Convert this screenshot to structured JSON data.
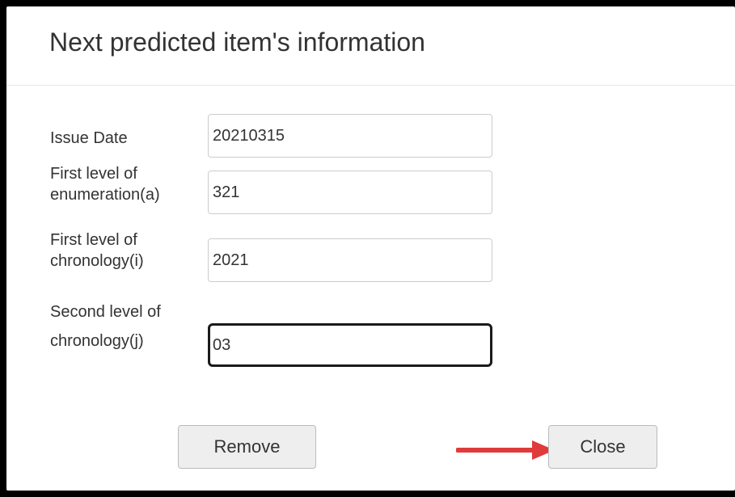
{
  "dialog": {
    "title": "Next predicted item's information"
  },
  "fields": {
    "issue_date": {
      "label": "Issue Date",
      "value": "20210315"
    },
    "enumeration_a": {
      "label": "First level of enumeration(a)",
      "value": "321"
    },
    "chronology_i": {
      "label": "First level of chronology(i)",
      "value": "2021"
    },
    "chronology_j": {
      "label": "Second level of chronology(j)",
      "value": "03"
    }
  },
  "buttons": {
    "remove_label": "Remove",
    "close_label": "Close"
  },
  "annotation": {
    "arrow_color": "#e03b3b",
    "arrow_icon": "right-arrow-icon"
  }
}
